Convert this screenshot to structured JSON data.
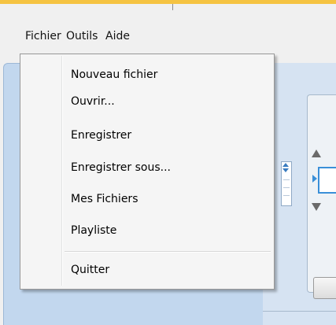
{
  "menubar": {
    "items": [
      "Fichier",
      "Outils",
      "Aide"
    ]
  },
  "file_menu": {
    "items": [
      {
        "label": "Nouveau fichier"
      },
      {
        "label": "Ouvrir..."
      },
      {
        "label": "Enregistrer"
      },
      {
        "label": "Enregistrer sous..."
      },
      {
        "label": "Mes Fichiers"
      },
      {
        "label": "Playliste"
      },
      {
        "label": "Quitter"
      }
    ]
  },
  "colors": {
    "accent": "#f5c342",
    "panel_blue": "#c2d7ee",
    "highlight_blue": "#3a8fd8"
  }
}
